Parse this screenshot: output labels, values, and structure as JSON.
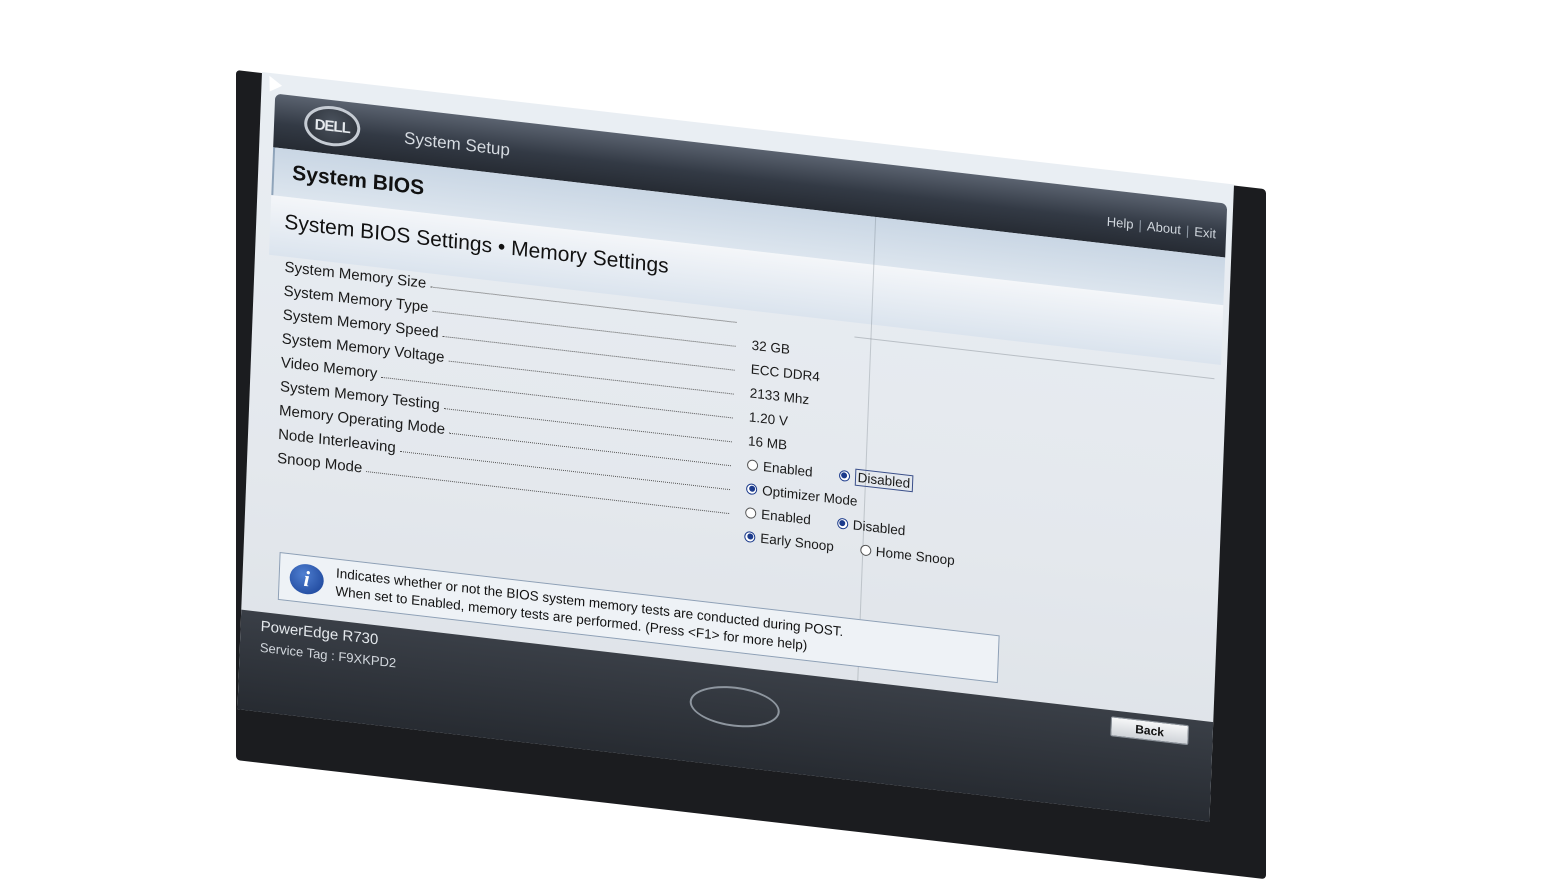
{
  "header": {
    "logo_text": "DELL",
    "app_title": "System Setup",
    "links": {
      "help": "Help",
      "about": "About",
      "exit": "Exit",
      "sep": "|"
    }
  },
  "section": {
    "title": "System BIOS"
  },
  "page": {
    "title": "System BIOS Settings • Memory Settings"
  },
  "settings": [
    {
      "label": "System Memory Size",
      "value": ""
    },
    {
      "label": "System Memory Type",
      "value": "32 GB"
    },
    {
      "label": "System Memory Speed",
      "value": "ECC DDR4"
    },
    {
      "label": "System Memory Voltage",
      "value": "2133 Mhz"
    },
    {
      "label": "Video Memory",
      "value": "1.20 V"
    },
    {
      "label": "System Memory Testing",
      "value": "16 MB"
    },
    {
      "label": "Memory Operating Mode",
      "options": [
        {
          "label": "Enabled",
          "selected": false
        },
        {
          "label": "Disabled",
          "selected": true
        }
      ]
    },
    {
      "label": "Node Interleaving",
      "options": [
        {
          "label": "Optimizer Mode",
          "selected": true
        }
      ]
    },
    {
      "label": "Snoop Mode",
      "options": [
        {
          "label": "Enabled",
          "selected": false
        },
        {
          "label": "Disabled",
          "selected": true
        }
      ]
    },
    {
      "label": "",
      "options": [
        {
          "label": "Early Snoop",
          "selected": true
        },
        {
          "label": "Home Snoop",
          "selected": false
        }
      ]
    }
  ],
  "info": {
    "icon": "info-icon",
    "line1": "Indicates whether or not the BIOS system memory tests are conducted during POST.",
    "line2": "When set to Enabled, memory tests are performed. (Press <F1> for more help)"
  },
  "footer": {
    "model": "PowerEdge R730",
    "service_tag": "Service Tag : F9XKPD2",
    "back_label": "Back"
  },
  "colors": {
    "header": "#333a45",
    "radio_selected": "#1c3b8c",
    "info_icon": "#163e93"
  }
}
